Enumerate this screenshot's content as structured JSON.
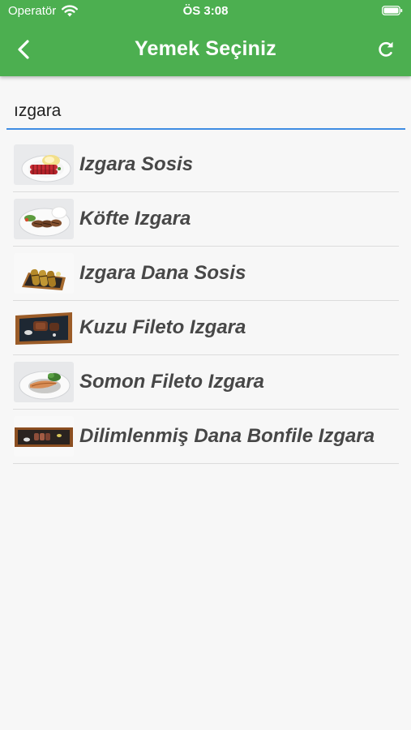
{
  "status_bar": {
    "carrier": "Operatör",
    "time": "ÖS 3:08"
  },
  "app_bar": {
    "title": "Yemek Seçiniz",
    "color": "#4caf50"
  },
  "search": {
    "value": "ızgara",
    "underline_color": "#3f8de3"
  },
  "foods": [
    {
      "name": "Izgara Sosis",
      "icon": "grilled-sausage-plate-thumbnail"
    },
    {
      "name": "Köfte Izgara",
      "icon": "meatball-plate-thumbnail"
    },
    {
      "name": "Izgara Dana Sosis",
      "icon": "beef-sausage-board-thumbnail"
    },
    {
      "name": "Kuzu Fileto Izgara",
      "icon": "lamb-fillet-board-thumbnail"
    },
    {
      "name": "Somon Fileto Izgara",
      "icon": "salmon-fillet-plate-thumbnail"
    },
    {
      "name": "Dilimlenmiş Dana Bonfile Izgara",
      "icon": "sliced-beef-tenderloin-board-thumbnail"
    }
  ]
}
